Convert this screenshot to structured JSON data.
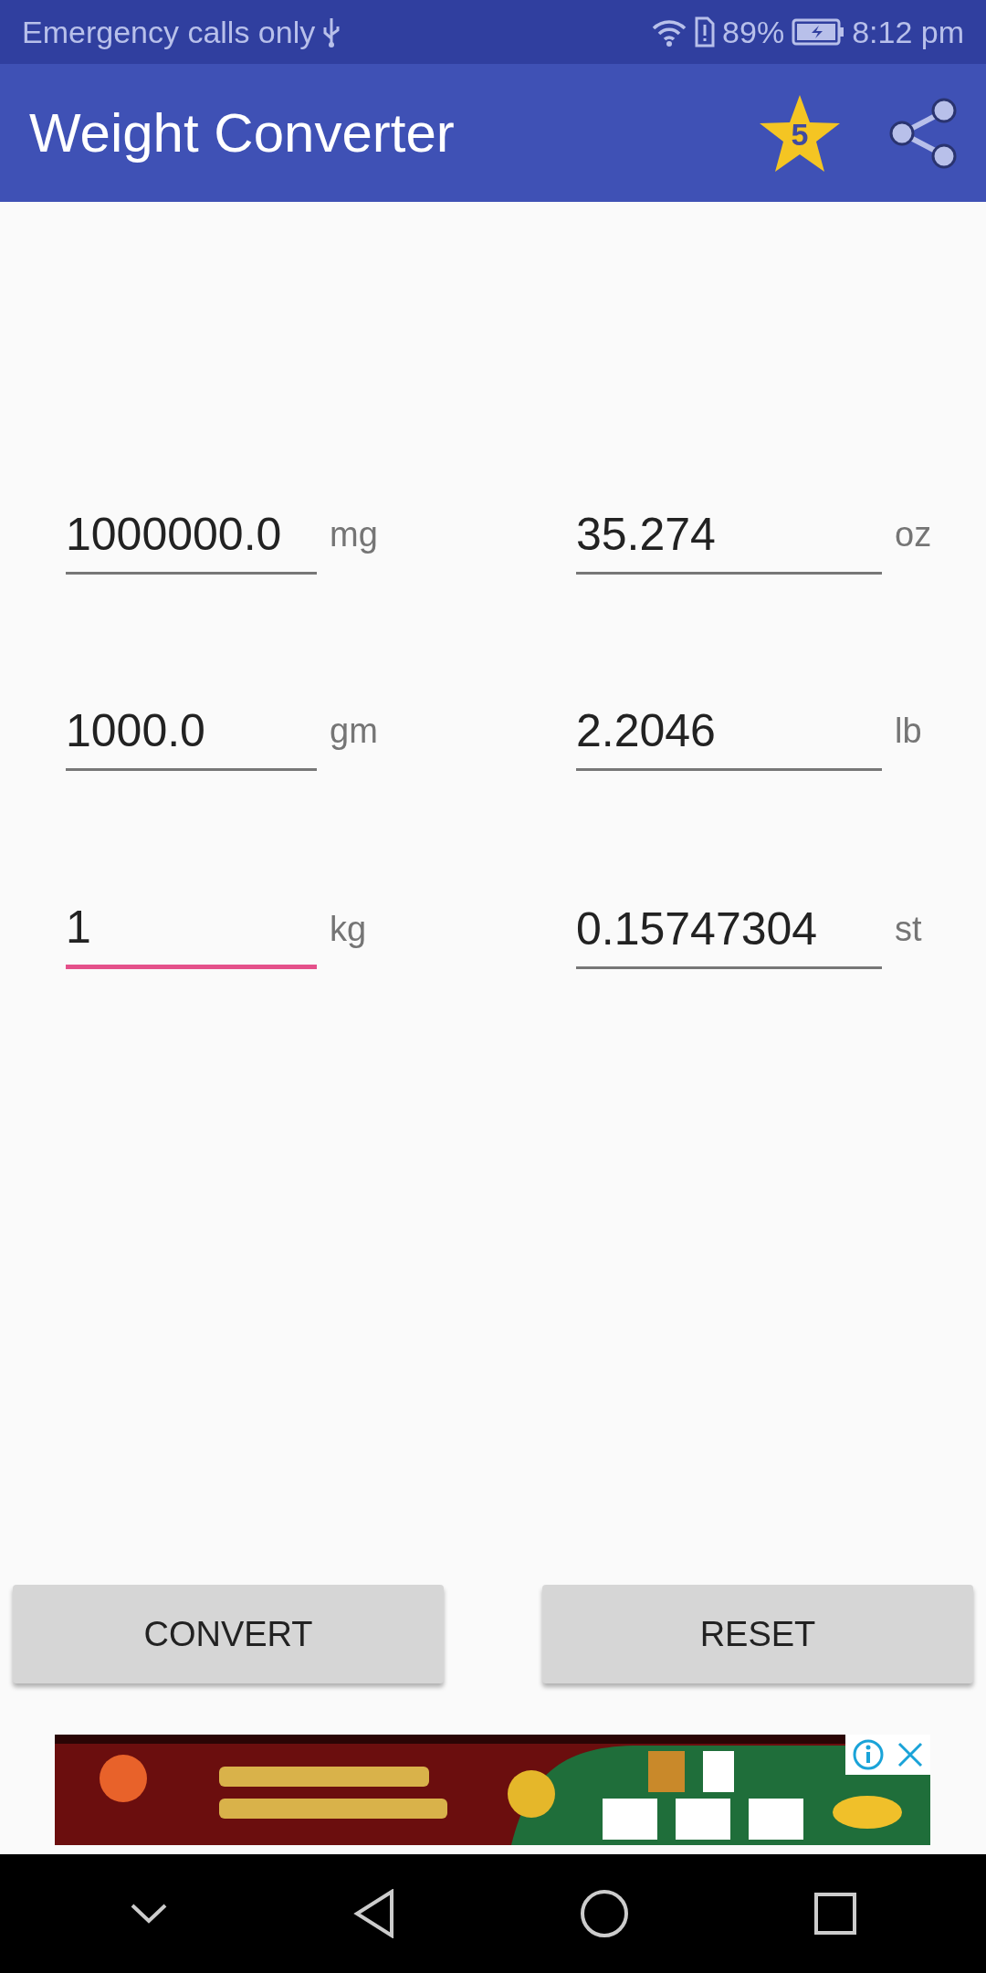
{
  "status_bar": {
    "carrier": "Emergency calls only",
    "battery": "89%",
    "time": "8:12 pm"
  },
  "app_bar": {
    "title": "Weight Converter",
    "rating_badge": "5"
  },
  "fields": [
    {
      "value": "1000000.0",
      "unit": "mg",
      "focused": false
    },
    {
      "value": "35.274",
      "unit": "oz",
      "focused": false
    },
    {
      "value": "1000.0",
      "unit": "gm",
      "focused": false
    },
    {
      "value": "2.2046",
      "unit": "lb",
      "focused": false
    },
    {
      "value": "1",
      "unit": "kg",
      "focused": true
    },
    {
      "value": "0.15747304",
      "unit": "st",
      "focused": false
    }
  ],
  "buttons": [
    "CONVERT",
    "RESET"
  ]
}
